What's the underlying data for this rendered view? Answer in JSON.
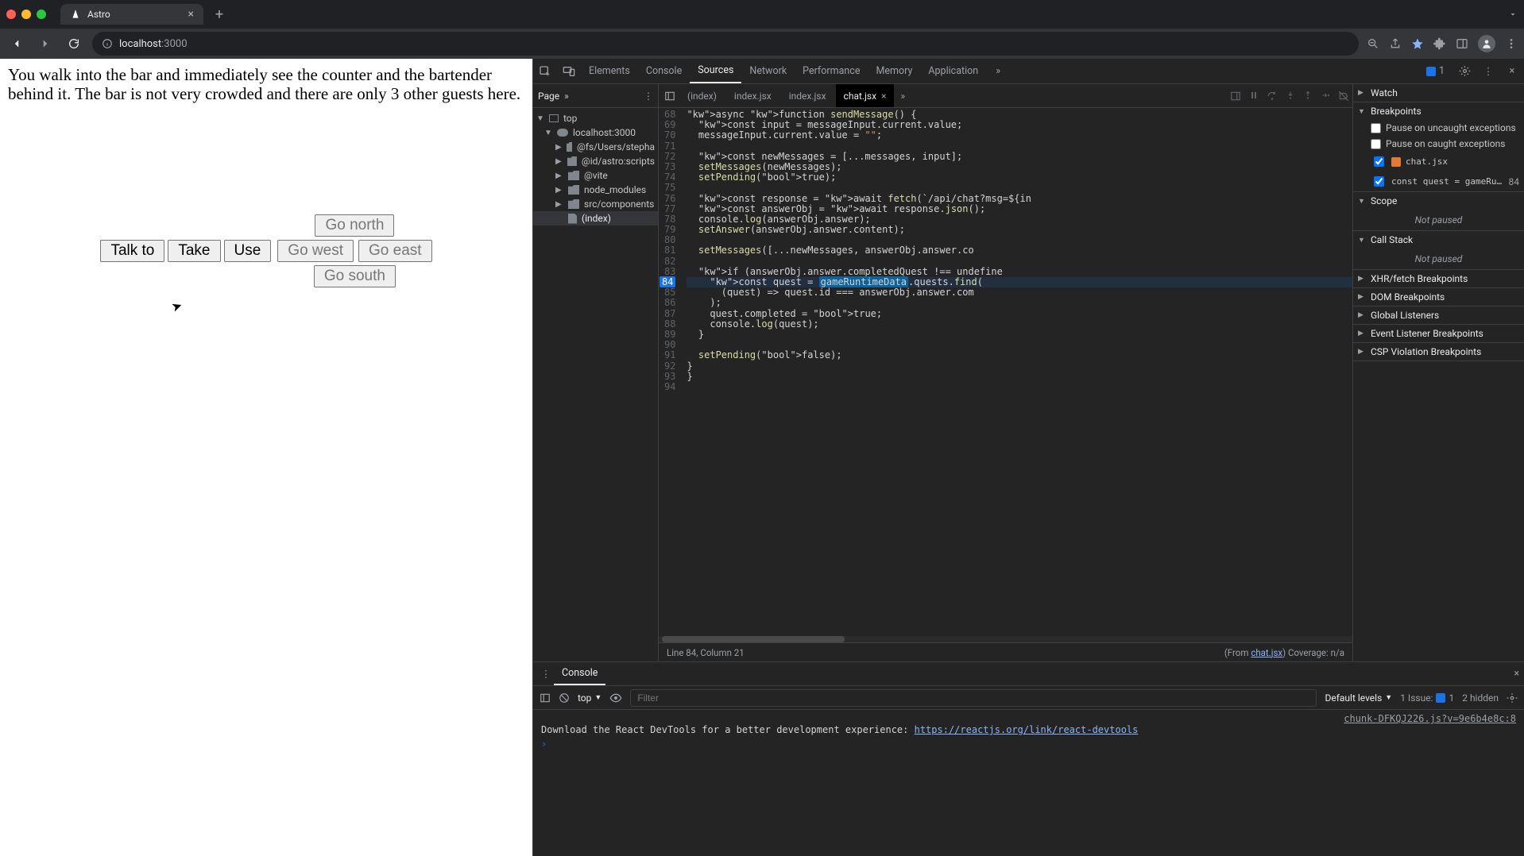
{
  "browser": {
    "tab_title": "Astro",
    "url_host": "localhost",
    "url_port": ":3000",
    "toolbar_icons": [
      "back",
      "forward",
      "reload",
      "info",
      "zoom",
      "share",
      "bookmark",
      "extensions",
      "sidepanel",
      "profile",
      "menu"
    ]
  },
  "app": {
    "narrative": "You walk into the bar and immediately see the counter and the bartender behind it. The bar is not very crowded and there are only 3 other guests here.",
    "actions": {
      "talk": "Talk to",
      "take": "Take",
      "use": "Use"
    },
    "dirs": {
      "north": "Go north",
      "west": "Go west",
      "east": "Go east",
      "south": "Go south"
    }
  },
  "devtools": {
    "panels": [
      "Elements",
      "Console",
      "Sources",
      "Network",
      "Performance",
      "Memory",
      "Application"
    ],
    "active_panel": "Sources",
    "issue_count": "1",
    "files_tab": "Page",
    "tree": {
      "top": "top",
      "host": "localhost:3000",
      "folders": [
        "@fs/Users/stepha",
        "@id/astro:scripts",
        "@vite",
        "node_modules",
        "src/components"
      ],
      "leaf": "(index)"
    },
    "editor_tabs": [
      "(index)",
      "index.jsx",
      "index.jsx",
      "chat.jsx"
    ],
    "active_editor_tab": "chat.jsx",
    "line_start": 68,
    "breakpoint_line": 84,
    "code_lines": [
      {
        "n": 68,
        "t": "async function sendMessage() {",
        "cls": ""
      },
      {
        "n": 69,
        "t": "  const input = messageInput.current.value;",
        "cls": ""
      },
      {
        "n": 70,
        "t": "  messageInput.current.value = \"\";",
        "cls": ""
      },
      {
        "n": 71,
        "t": "",
        "cls": ""
      },
      {
        "n": 72,
        "t": "  const newMessages = [...messages, input];",
        "cls": ""
      },
      {
        "n": 73,
        "t": "  setMessages(newMessages);",
        "cls": ""
      },
      {
        "n": 74,
        "t": "  setPending(true);",
        "cls": ""
      },
      {
        "n": 75,
        "t": "",
        "cls": ""
      },
      {
        "n": 76,
        "t": "  const response = await fetch(`/api/chat?msg=${in",
        "cls": ""
      },
      {
        "n": 77,
        "t": "  const answerObj = await response.json();",
        "cls": ""
      },
      {
        "n": 78,
        "t": "  console.log(answerObj.answer);",
        "cls": ""
      },
      {
        "n": 79,
        "t": "  setAnswer(answerObj.answer.content);",
        "cls": ""
      },
      {
        "n": 80,
        "t": "",
        "cls": ""
      },
      {
        "n": 81,
        "t": "  setMessages([...newMessages, answerObj.answer.co",
        "cls": ""
      },
      {
        "n": 82,
        "t": "",
        "cls": ""
      },
      {
        "n": 83,
        "t": "  if (answerObj.answer.completedQuest !== undefine",
        "cls": ""
      },
      {
        "n": 84,
        "t": "    const quest = ▶gameRuntimeData.quests.find(",
        "cls": "bp"
      },
      {
        "n": 85,
        "t": "      (quest) => quest.id === answerObj.answer.com",
        "cls": ""
      },
      {
        "n": 86,
        "t": "    );",
        "cls": ""
      },
      {
        "n": 87,
        "t": "    quest.completed = true;",
        "cls": ""
      },
      {
        "n": 88,
        "t": "    console.log(quest);",
        "cls": ""
      },
      {
        "n": 89,
        "t": "  }",
        "cls": ""
      },
      {
        "n": 90,
        "t": "",
        "cls": ""
      },
      {
        "n": 91,
        "t": "  setPending(false);",
        "cls": ""
      },
      {
        "n": 92,
        "t": "}",
        "cls": ""
      },
      {
        "n": 93,
        "t": "}",
        "cls": ""
      },
      {
        "n": 94,
        "t": "",
        "cls": ""
      }
    ],
    "status_left": "Line 84, Column 21",
    "status_from": "(From ",
    "status_link": "chat.jsx",
    "status_right": ") Coverage: n/a",
    "dbg": {
      "watch": "Watch",
      "breakpoints": "Breakpoints",
      "bp_uncaught": "Pause on uncaught exceptions",
      "bp_caught": "Pause on caught exceptions",
      "bp_file": "chat.jsx",
      "bp_code": "const quest = gameRu…",
      "bp_line": "84",
      "scope": "Scope",
      "not_paused1": "Not paused",
      "callstack": "Call Stack",
      "not_paused2": "Not paused",
      "sections": [
        "XHR/fetch Breakpoints",
        "DOM Breakpoints",
        "Global Listeners",
        "Event Listener Breakpoints",
        "CSP Violation Breakpoints"
      ]
    }
  },
  "console_drawer": {
    "title": "Console",
    "context": "top",
    "filter_placeholder": "Filter",
    "levels": "Default levels",
    "issue_label": "1 Issue:",
    "issue_count": "1",
    "hidden": "2 hidden",
    "src_link": "chunk-DFKQJ226.js?v=9e6b4e8c:8",
    "msg_pre": "Download the React DevTools for a better development experience: ",
    "msg_link": "https://reactjs.org/link/react-devtools"
  }
}
